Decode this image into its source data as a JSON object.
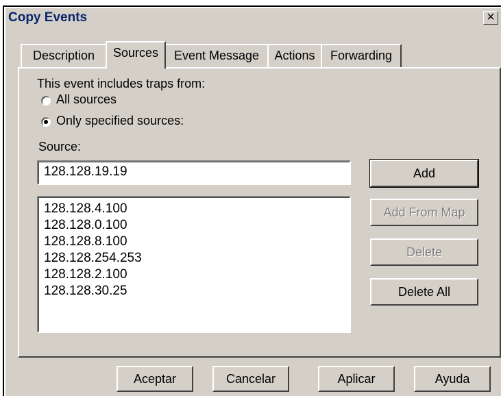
{
  "window": {
    "title": "Copy Events",
    "close_glyph": "×"
  },
  "tabs": [
    {
      "label": "Description",
      "active": false
    },
    {
      "label": "Sources",
      "active": true
    },
    {
      "label": "Event Message",
      "active": false
    },
    {
      "label": "Actions",
      "active": false
    },
    {
      "label": "Forwarding",
      "active": false
    }
  ],
  "sources": {
    "intro": "This event includes traps from:",
    "radio_all": {
      "label": "All sources",
      "checked": false
    },
    "radio_specified": {
      "label": "Only specified sources:",
      "checked": true
    },
    "source_label": "Source:",
    "source_value": "128.128.19.19",
    "list": [
      "128.128.4.100",
      "128.128.0.100",
      "128.128.8.100",
      "128.128.254.253",
      "128.128.2.100",
      "128.128.30.25"
    ],
    "buttons": {
      "add": "Add",
      "add_from_map": "Add From Map",
      "delete": "Delete",
      "delete_all": "Delete All"
    }
  },
  "footer": {
    "ok": "Aceptar",
    "cancel": "Cancelar",
    "apply": "Aplicar",
    "help": "Ayuda"
  }
}
